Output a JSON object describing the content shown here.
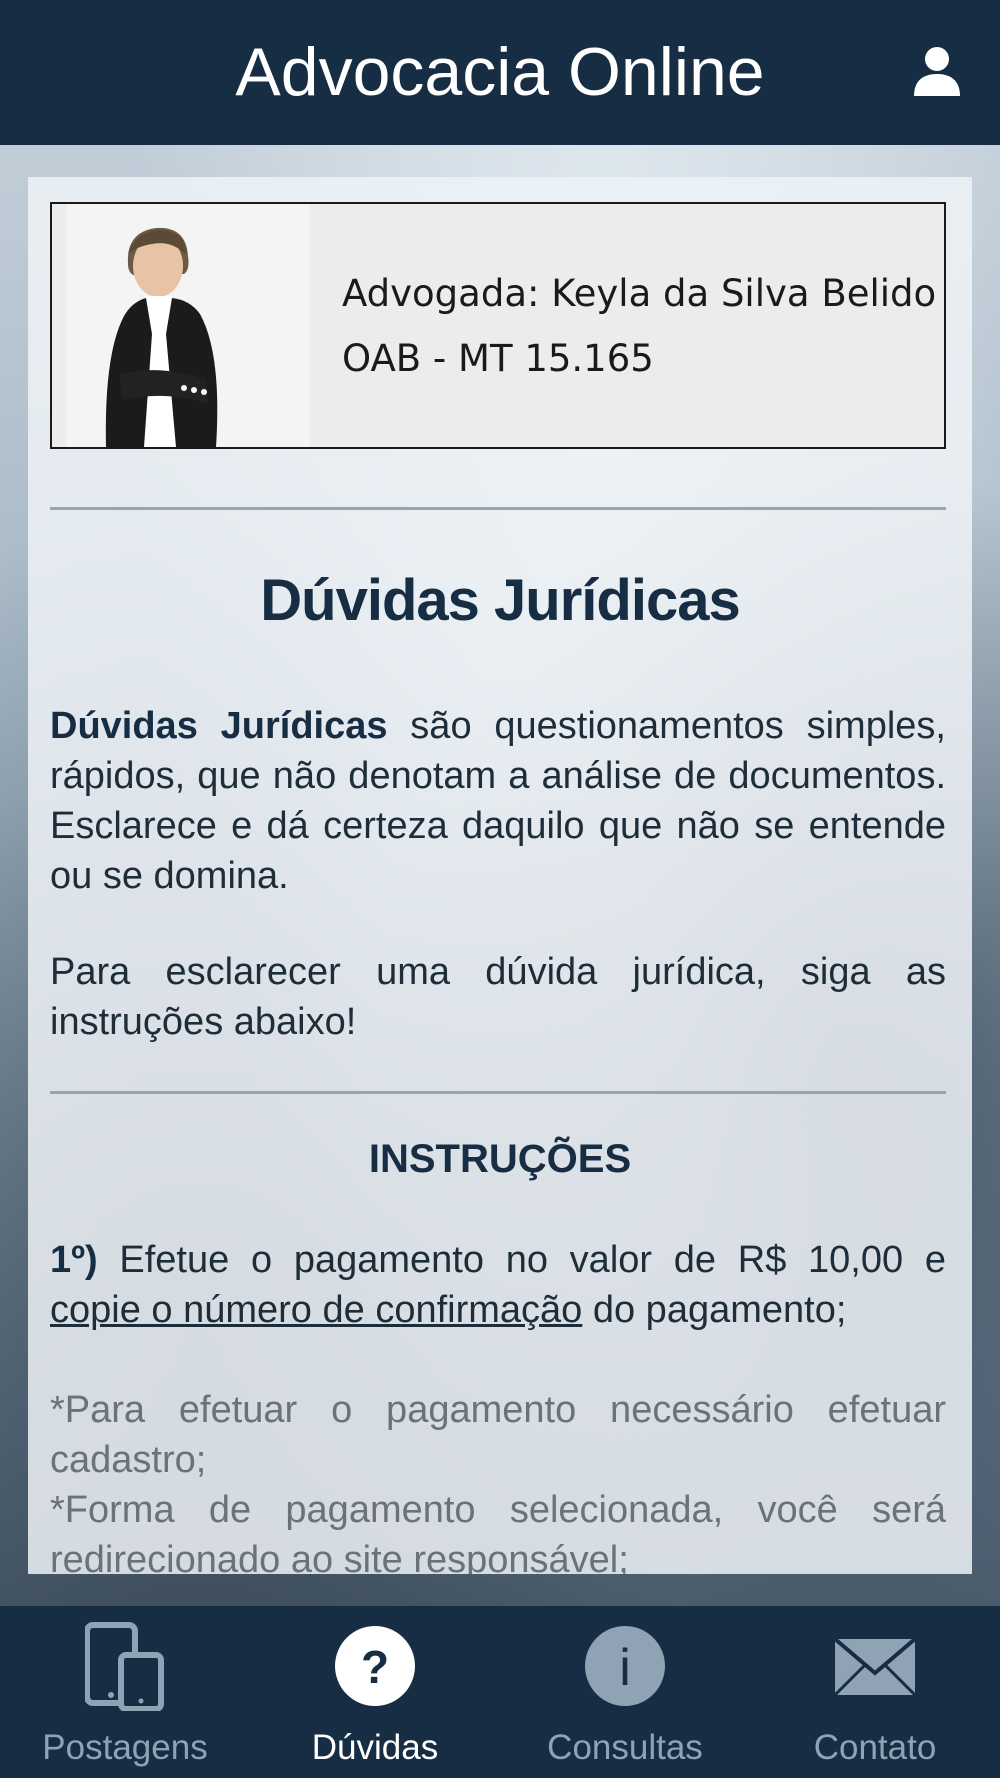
{
  "header": {
    "title": "Advocacia Online",
    "user_icon": "user-icon"
  },
  "banner": {
    "line1": "Advogada: Keyla da Silva Belido",
    "line2": "OAB - MT 15.165"
  },
  "main": {
    "heading": "Dúvidas Jurídicas",
    "p1_bold": "Dúvidas Jurídicas",
    "p1_text": " são questionamentos simples, rápidos, que não denotam a análise de documentos. Esclarece e dá certeza daquilo que não se entende ou se domina.",
    "p2": "Para esclarecer uma dúvida jurídica, siga as instruções abaixo!",
    "instructions_heading": "INSTRUÇÕES",
    "step1_num": "1º)",
    "step1_text": " Efetue o pagamento no valor de R$ 10,00 e ",
    "step1_link": "copie o número de confirmação",
    "step1_end": " do pagamento;",
    "note1": "*Para efetuar o pagamento necessário efetuar cadastro;",
    "note2": "*Forma de pagamento selecionada, você será redirecionado ao site responsável;"
  },
  "tabs": [
    {
      "label": "Postagens",
      "icon": "devices-icon",
      "active": false
    },
    {
      "label": "Dúvidas",
      "icon": "question-icon",
      "active": true
    },
    {
      "label": "Consultas",
      "icon": "info-icon",
      "active": false
    },
    {
      "label": "Contato",
      "icon": "envelope-icon",
      "active": false
    }
  ],
  "colors": {
    "primary": "#172d44",
    "tab_inactive": "#8fa3b4",
    "tab_active": "#ffffff"
  }
}
